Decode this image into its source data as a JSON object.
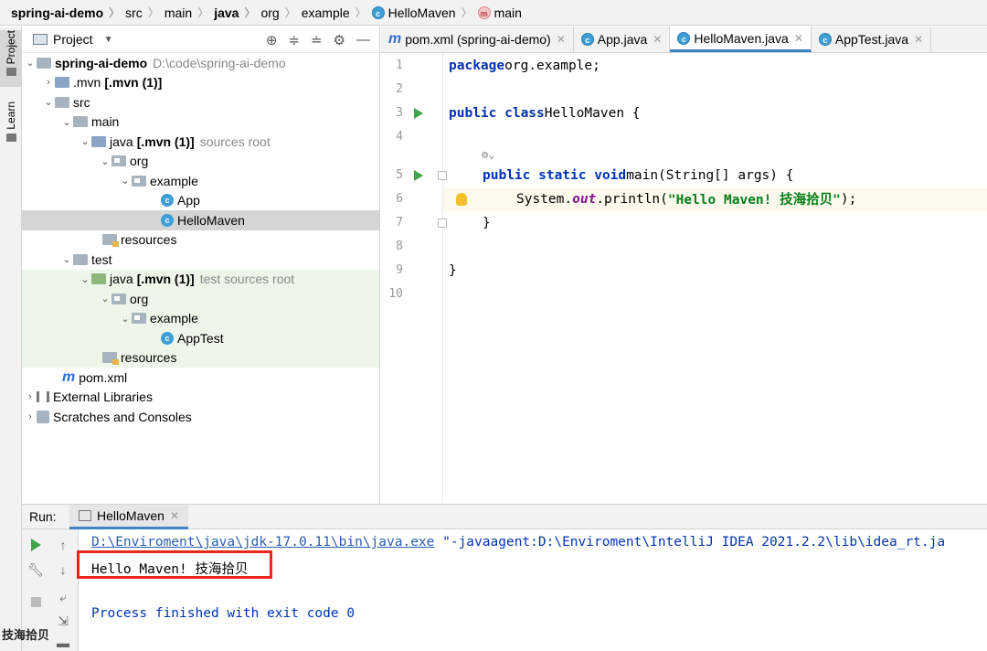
{
  "breadcrumb": {
    "items": [
      "spring-ai-demo",
      "src",
      "main",
      "java",
      "org",
      "example",
      "HelloMaven",
      "main"
    ]
  },
  "toolstrip": {
    "project_tab": "Project",
    "learn_tab": "Learn"
  },
  "project_panel": {
    "title": "Project",
    "tree": {
      "root_name": "spring-ai-demo",
      "root_path": "D:\\code\\spring-ai-demo",
      "mvn_dir": ".mvn",
      "mvn_tag": "[.mvn (1)]",
      "src": "src",
      "main": "main",
      "java": "java",
      "java_tag": "[.mvn (1)]",
      "sources_root": "sources root",
      "org": "org",
      "example": "example",
      "app": "App",
      "hellomaven": "HelloMaven",
      "resources": "resources",
      "test": "test",
      "test_java": "java",
      "test_java_tag": "[.mvn (1)]",
      "test_sources_root": "test sources root",
      "test_org": "org",
      "test_example": "example",
      "apptest": "AppTest",
      "test_resources": "resources",
      "pom": "pom.xml",
      "external_libraries": "External Libraries",
      "scratches": "Scratches and Consoles"
    }
  },
  "editor_tabs": [
    {
      "label": "pom.xml (spring-ai-demo)"
    },
    {
      "label": "App.java"
    },
    {
      "label": "HelloMaven.java"
    },
    {
      "label": "AppTest.java"
    }
  ],
  "editor": {
    "line_numbers": [
      "1",
      "2",
      "3",
      "4",
      "5",
      "6",
      "7",
      "8",
      "9",
      "10"
    ],
    "code": {
      "l1_kw": "package",
      "l1_rest": " org.example;",
      "l3_kw": "public class",
      "l3_rest": " HelloMaven {",
      "l5_kw": "public static void",
      "l5_rest": " main(String[] args) {",
      "l6_a": "System.",
      "l6_field": "out",
      "l6_b": ".println(",
      "l6_str": "\"Hello Maven! 技海拾贝\"",
      "l6_c": ");",
      "l7": "}",
      "l9": "}"
    }
  },
  "run_panel": {
    "label": "Run:",
    "tab": "HelloMaven",
    "console": {
      "cmd_path": "D:\\Enviroment\\java\\jdk-17.0.11\\bin\\java.exe",
      "cmd_args": " \"-javaagent:D:\\Enviroment\\IntelliJ IDEA 2021.2.2\\lib\\idea_rt.ja",
      "output": "Hello Maven! 技海拾贝",
      "process": "Process finished with exit code 0"
    }
  },
  "watermark": "技海拾贝",
  "colors": {
    "accent": "#4083c9",
    "highlight_box": "#e8261b",
    "run_green": "#3ea549"
  }
}
